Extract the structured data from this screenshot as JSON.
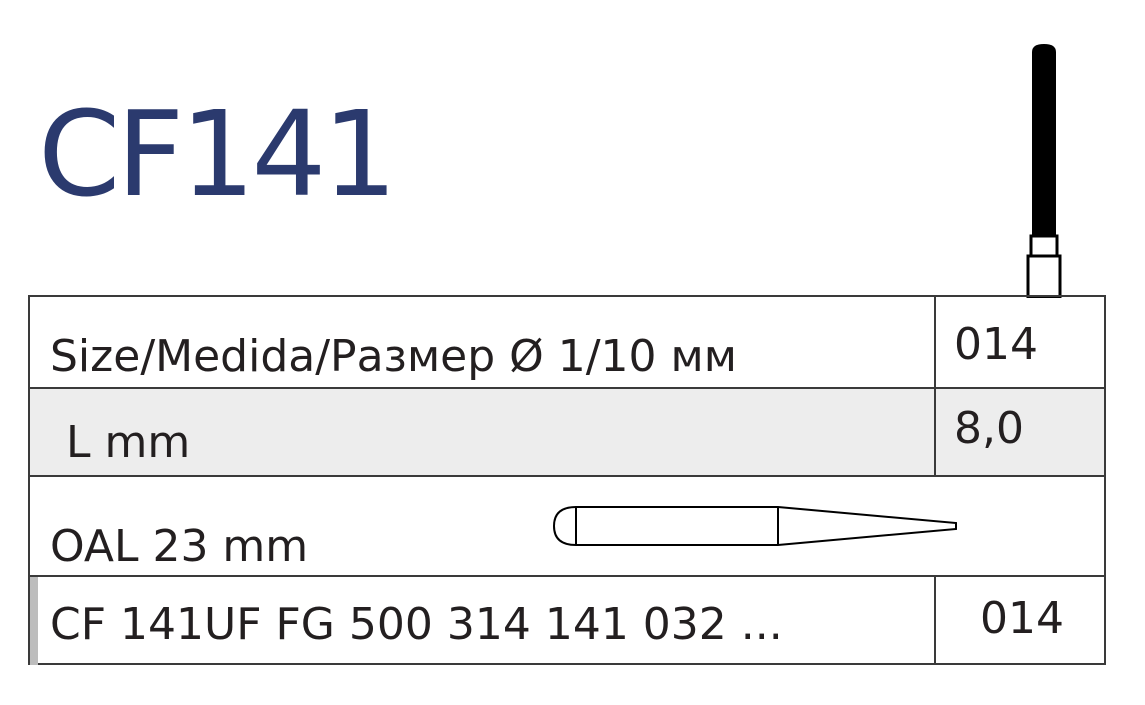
{
  "product": {
    "code": "CF141"
  },
  "table": {
    "size_label": "Size/Medida/Размер Ø 1/10 мм",
    "size_value": "014",
    "length_label": "L mm",
    "length_value": "8,0",
    "oal_label": "OAL 23 mm",
    "reference_label": "CF 141UF FG 500 314 141 032 ...",
    "reference_value": "014"
  },
  "colors": {
    "title": "#2b3a6e",
    "shaded_row": "#ededed",
    "border": "#3a3a3a"
  },
  "icons": {
    "top": "bur-upright-icon",
    "inline": "bur-side-view-icon"
  }
}
